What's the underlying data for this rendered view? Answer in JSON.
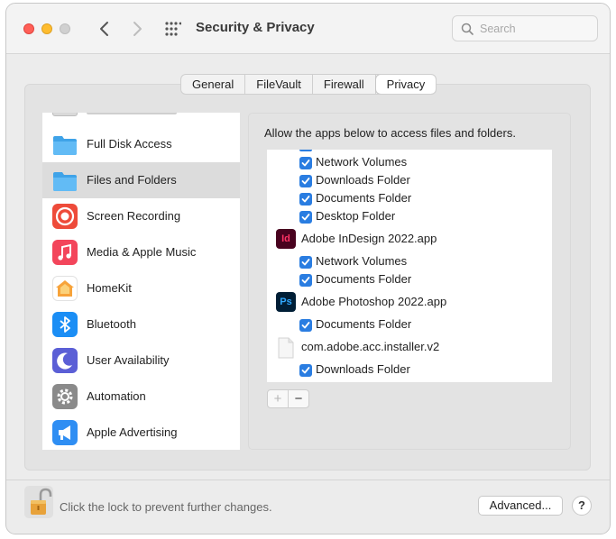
{
  "window": {
    "title": "Security & Privacy",
    "search_placeholder": "Search"
  },
  "tabs": [
    {
      "label": "General",
      "active": false
    },
    {
      "label": "FileVault",
      "active": false
    },
    {
      "label": "Firewall",
      "active": false
    },
    {
      "label": "Privacy",
      "active": true
    }
  ],
  "sidebar": {
    "selected": "Files and Folders",
    "items": [
      {
        "label": "Full Disk Access",
        "icon": "folder-icon",
        "color": "#4fb3f0"
      },
      {
        "label": "Files and Folders",
        "icon": "folder-icon",
        "color": "#4fb3f0"
      },
      {
        "label": "Screen Recording",
        "icon": "screen-recording-icon",
        "color": "#ee4b3a"
      },
      {
        "label": "Media & Apple Music",
        "icon": "music-note-icon",
        "color": "#f3455b"
      },
      {
        "label": "HomeKit",
        "icon": "home-icon",
        "color": "#f7a33a"
      },
      {
        "label": "Bluetooth",
        "icon": "bluetooth-icon",
        "color": "#1b8ef5"
      },
      {
        "label": "User Availability",
        "icon": "moon-icon",
        "color": "#5b5fd6"
      },
      {
        "label": "Automation",
        "icon": "gear-icon",
        "color": "#8a8a8a"
      },
      {
        "label": "Apple Advertising",
        "icon": "megaphone-icon",
        "color": "#2f8ef3"
      }
    ]
  },
  "main": {
    "allow_text": "Allow the apps below to access files and folders.",
    "rows": [
      {
        "kind": "perm",
        "label": "Network Volumes",
        "checked": true
      },
      {
        "kind": "perm",
        "label": "Downloads Folder",
        "checked": true
      },
      {
        "kind": "perm",
        "label": "Documents Folder",
        "checked": true
      },
      {
        "kind": "perm",
        "label": "Desktop Folder",
        "checked": true
      },
      {
        "kind": "app",
        "label": "Adobe InDesign 2022.app",
        "icon": "indesign-icon",
        "icon_text": "Id",
        "color": "#49021f"
      },
      {
        "kind": "perm",
        "label": "Network Volumes",
        "checked": true
      },
      {
        "kind": "perm",
        "label": "Documents Folder",
        "checked": true
      },
      {
        "kind": "app",
        "label": "Adobe Photoshop 2022.app",
        "icon": "photoshop-icon",
        "icon_text": "Ps",
        "color": "#001e36"
      },
      {
        "kind": "perm",
        "label": "Documents Folder",
        "checked": true
      },
      {
        "kind": "app",
        "label": "com.adobe.acc.installer.v2",
        "icon": "document-icon",
        "icon_text": "",
        "color": "#f5f5f5"
      },
      {
        "kind": "perm",
        "label": "Downloads Folder",
        "checked": true
      }
    ],
    "plus_label": "+",
    "minus_label": "−"
  },
  "footer": {
    "lock_text": "Click the lock to prevent further changes.",
    "advanced_label": "Advanced...",
    "help_label": "?"
  }
}
